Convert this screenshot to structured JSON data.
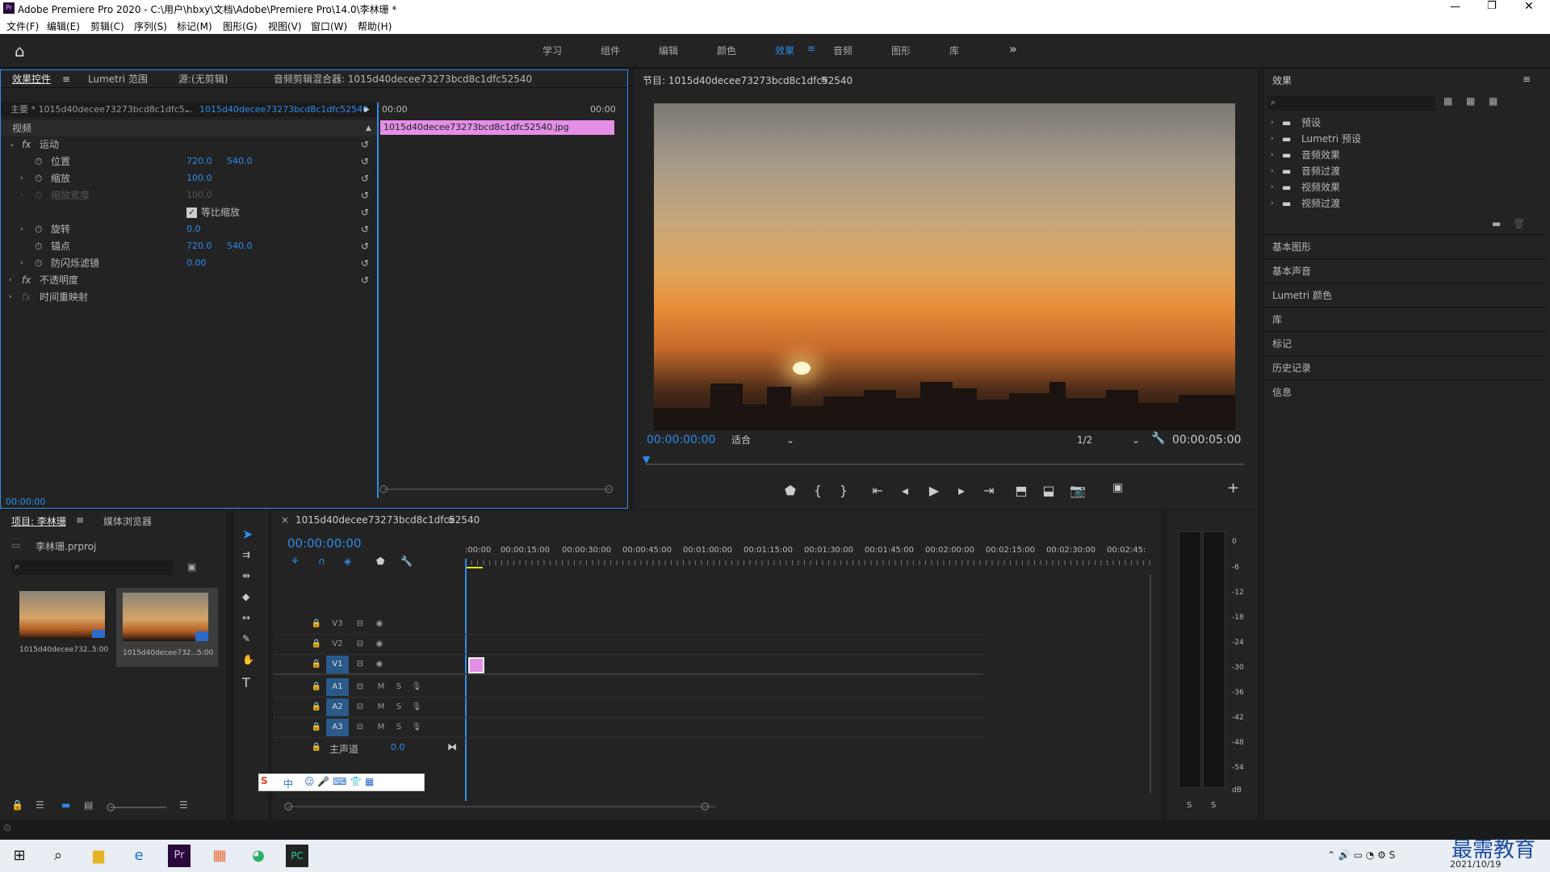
{
  "window": {
    "title": "Adobe Premiere Pro 2020 - C:\\用户\\hbxy\\文档\\Adobe\\Premiere Pro\\14.0\\李林珊 *"
  },
  "menu": [
    "文件(F)",
    "编辑(E)",
    "剪辑(C)",
    "序列(S)",
    "标记(M)",
    "图形(G)",
    "视图(V)",
    "窗口(W)",
    "帮助(H)"
  ],
  "workspaces": [
    "学习",
    "组件",
    "编辑",
    "颜色",
    "效果",
    "音频",
    "图形",
    "库"
  ],
  "active_workspace": "效果",
  "effect_controls": {
    "tabs": [
      "效果控件",
      "Lumetri 范围",
      "源:(无剪辑)",
      "音频剪辑混合器: 1015d40decee73273bcd8c1dfc52540"
    ],
    "master": "主要 * 1015d40decee73273bcd8c1dfc5...",
    "sequence": "1015d40decee73273bcd8c1dfc52540 ...",
    "time_start": "00:00",
    "time_end": "00:00",
    "clip_name": "1015d40decee73273bcd8c1dfc52540.jpg",
    "video_label": "视频",
    "motion_label": "运动",
    "props": [
      {
        "name": "位置",
        "v1": "720.0",
        "v2": "540.0"
      },
      {
        "name": "缩放",
        "v1": "100.0",
        "v2": ""
      },
      {
        "name": "缩放宽度",
        "v1": "100.0",
        "v2": ""
      },
      {
        "name": "等比缩放",
        "v1": "",
        "v2": ""
      },
      {
        "name": "旋转",
        "v1": "0.0",
        "v2": ""
      },
      {
        "name": "锚点",
        "v1": "720.0",
        "v2": "540.0"
      },
      {
        "name": "防闪烁滤镜",
        "v1": "0.00",
        "v2": ""
      }
    ],
    "opacity_label": "不透明度",
    "timeremap_label": "时间重映射",
    "timecode": "00:00:00"
  },
  "program": {
    "title": "节目: 1015d40decee73273bcd8c1dfc52540",
    "timecode": "00:00:00:00",
    "fit": "适合",
    "resolution": "1/2",
    "duration": "00:00:05:00"
  },
  "effects_panel": {
    "title": "效果",
    "folders": [
      "预设",
      "Lumetri 预设",
      "音频效果",
      "音频过渡",
      "视频效果",
      "视频过渡"
    ],
    "sections": [
      "基本图形",
      "基本声音",
      "Lumetri 颜色",
      "库",
      "标记",
      "历史记录",
      "信息"
    ]
  },
  "project": {
    "tabs": [
      "项目: 李林珊",
      "媒体浏览器"
    ],
    "file": "李林珊.prproj",
    "items": [
      {
        "name": "1015d40decee732...",
        "dur": "5:00"
      },
      {
        "name": "1015d40decee732...",
        "dur": "5:00"
      }
    ]
  },
  "timeline": {
    "tab": "1015d40decee73273bcd8c1dfc52540",
    "timecode": "00:00:00:00",
    "ruler": [
      ":00:00",
      "00:00:15:00",
      "00:00:30:00",
      "00:00:45:00",
      "00:01:00:00",
      "00:01:15:00",
      "00:01:30:00",
      "00:01:45:00",
      "00:02:00:00",
      "00:02:15:00",
      "00:02:30:00",
      "00:02:45:"
    ],
    "video_tracks": [
      "V3",
      "V2",
      "V1"
    ],
    "audio_tracks": [
      "A1",
      "A2",
      "A3"
    ],
    "master_label": "主声道",
    "master_value": "0.0"
  },
  "audio_meter": {
    "scale": [
      "0",
      "-6",
      "-12",
      "-18",
      "-24",
      "-30",
      "-36",
      "-42",
      "-48",
      "-54",
      "dB"
    ],
    "solo": [
      "S",
      "S"
    ]
  },
  "ime": {
    "label": "中"
  },
  "taskbar": {
    "date": "2021/10/19",
    "watermark": "最需教育"
  },
  "colors": {
    "accent": "#2d8ceb",
    "clip": "#e48ee6",
    "panel": "#232323"
  }
}
